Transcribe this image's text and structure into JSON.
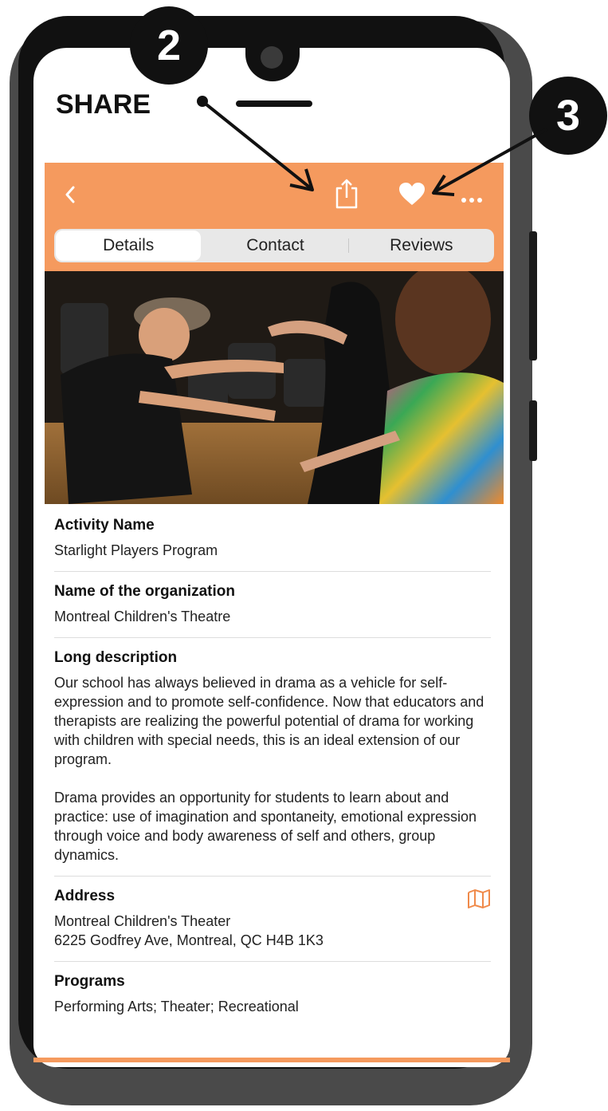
{
  "annotations": {
    "badge_2": "2",
    "badge_3": "3",
    "share_label": "SHARE"
  },
  "header": {
    "back_icon": "chevron-left-icon",
    "share_icon": "share-icon",
    "favorite_icon": "heart-icon",
    "more_icon": "more-icon",
    "color": "#f59a5e"
  },
  "tabs": [
    {
      "label": "Details",
      "active": true
    },
    {
      "label": "Contact"
    },
    {
      "label": "Reviews"
    }
  ],
  "details": {
    "activity": {
      "title": "Activity Name",
      "value": "Starlight Players Program"
    },
    "organization": {
      "title": "Name of the organization",
      "value": "Montreal Children's Theatre"
    },
    "description": {
      "title": "Long description",
      "para1": "Our school has always believed in drama as a vehicle for self-expression and to promote self-confidence. Now that educators and therapists are realizing the powerful potential of drama for working with children with special needs, this is an ideal extension of our program.",
      "para2": "Drama provides an opportunity for students to learn about and practice: use of imagination and spontaneity, emotional expression through voice and body awareness of self and others, group dynamics."
    },
    "address": {
      "title": "Address",
      "line1": "Montreal Children's Theater",
      "line2": "6225 Godfrey Ave, Montreal, QC H4B 1K3",
      "map_icon": "map-icon"
    },
    "programs": {
      "title": "Programs",
      "value": "Performing Arts; Theater; Recreational"
    }
  }
}
